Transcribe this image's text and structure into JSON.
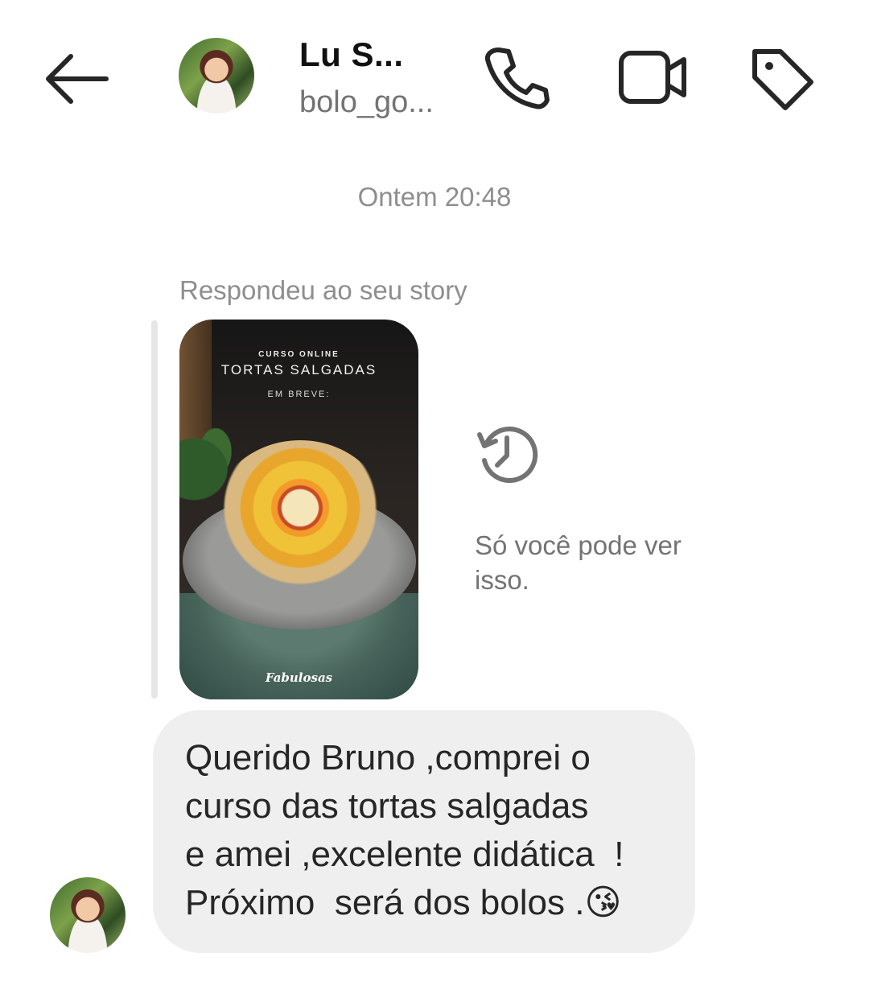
{
  "header": {
    "name": "Lu S...",
    "username": "bolo_go...",
    "icons": {
      "back": "arrow-left-icon",
      "call": "phone-icon",
      "video": "video-camera-icon",
      "tag": "tag-icon"
    }
  },
  "conversation": {
    "timestamp": "Ontem 20:48",
    "reply_label": "Respondeu ao seu story",
    "story": {
      "kicker": "CURSO ONLINE",
      "title": "TORTAS SALGADAS",
      "subtitle": "EM BREVE:",
      "brand": "Fabulosas"
    },
    "visibility_notice": "Só você pode ver isso.",
    "message": "Querido Bruno ,comprei o\ncurso das tortas salgadas\ne amei ,excelente didática  !\nPróximo  será dos bolos .😘"
  }
}
